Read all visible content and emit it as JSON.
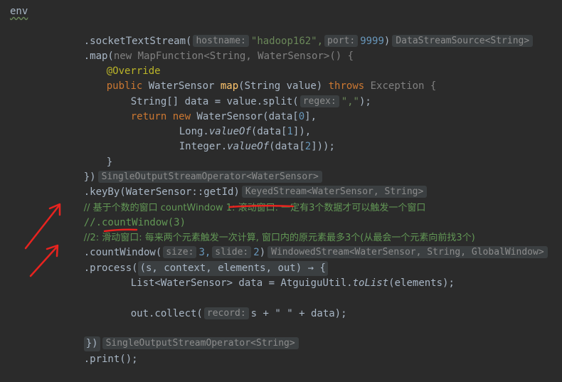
{
  "env_label": "env",
  "lines": {
    "l1": {
      "text": ".socketTextStream(",
      "hint1": "hostname:",
      "str1": "\"hadoop162\",",
      "hint2": "port:",
      "num": "9999",
      "close": ")",
      "type": "DataStreamSource<String>"
    },
    "l2": {
      "a": ".map(",
      "kw": "new",
      "b": " MapFunction<String, WaterSensor>() {"
    },
    "l3": {
      "ann": "@Override"
    },
    "l4": {
      "kw": "public",
      "a": " WaterSensor ",
      "fn": "map",
      "b": "(String value) ",
      "kw2": "throws",
      "c": " Exception {"
    },
    "l5": {
      "a": "String[] data = value.split(",
      "hint": "regex:",
      "str": "\",\"",
      "b": ");"
    },
    "l6": {
      "kw": "return new",
      "a": " WaterSensor(data[",
      "num": "0",
      "b": "],"
    },
    "l7": {
      "a": "Long.",
      "fn": "valueOf",
      "b": "(data[",
      "num": "1",
      "c": "]),"
    },
    "l8": {
      "a": "Integer.",
      "fn": "valueOf",
      "b": "(data[",
      "num": "2",
      "c": "]));"
    },
    "l9": {
      "a": "}"
    },
    "l10": {
      "a": "})",
      "type": "SingleOutputStreamOperator<WaterSensor>"
    },
    "l11": {
      "a": ".keyBy(WaterSensor::getId)",
      "type": "KeyedStream<WaterSensor, String>"
    },
    "l12": {
      "comment": "// 基于个数的窗口 countWindow 1: 滚动窗口: 一定有3个数据才可以触发一个窗口"
    },
    "l13": {
      "comment": "//.countWindow(3)"
    },
    "l14": {
      "comment": "//2: 滑动窗口: 每来两个元素触发一次计算, 窗口内的原元素最多3个(从最会一个元素向前找3个)"
    },
    "l15": {
      "a": ".countWindow(",
      "hint1": "size:",
      "num1": "3,",
      "hint2": "slide:",
      "num2": "2",
      "b": ")",
      "type": "WindowedStream<WaterSensor, String, GlobalWindow>"
    },
    "l16": {
      "a": ".process(",
      "lambda": "(s, context, elements, out) → {"
    },
    "l17": {
      "a": "List<WaterSensor> data = AtguiguUtil.",
      "fn": "toList",
      "b": "(elements);"
    },
    "l18": {
      "a": "out.collect(",
      "hint": "record:",
      "b": "s + \" \" + data);"
    },
    "l19": {
      "a": "})",
      "type": "SingleOutputStreamOperator<String>"
    },
    "l20": {
      "a": ".print();"
    }
  },
  "colors": {
    "background": "#2b2b2b",
    "keyword": "#cc7832",
    "string": "#6a8759",
    "number": "#6897bb",
    "function": "#ffc66d",
    "comment": "#629755",
    "annotation_red": "#e8231f"
  }
}
